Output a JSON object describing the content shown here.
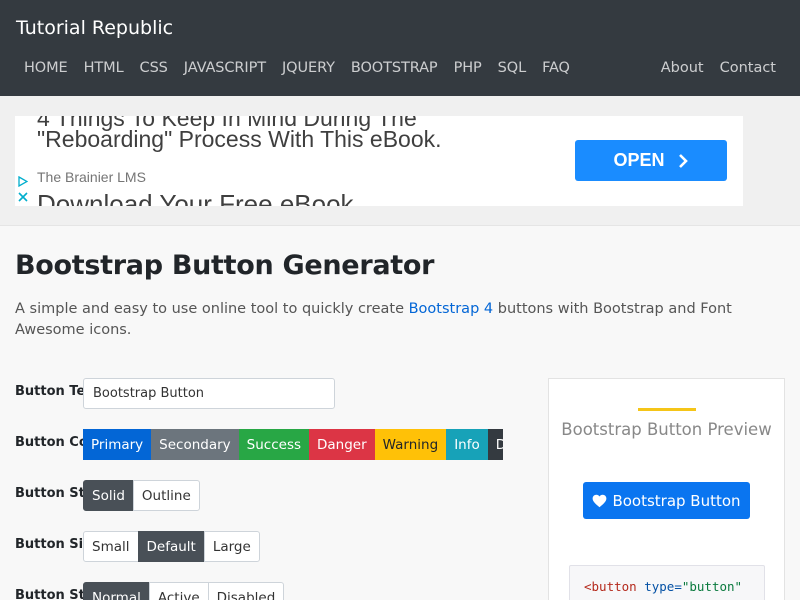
{
  "header": {
    "brand": "Tutorial Republic",
    "nav": [
      "HOME",
      "HTML",
      "CSS",
      "JAVASCRIPT",
      "JQUERY",
      "BOOTSTRAP",
      "PHP",
      "SQL",
      "FAQ"
    ],
    "nav_right": [
      "About",
      "Contact"
    ]
  },
  "ad": {
    "cut_top": "4 Things To Keep In Mind During The",
    "headline": "\"Reboarding\" Process With This eBook.",
    "source": "The Brainier LMS",
    "cut_bottom": "Download Your Free eBook",
    "button": "OPEN",
    "adchoices_icon": "play-triangle-icon",
    "close_icon": "close-icon"
  },
  "page": {
    "title": "Bootstrap Button Generator",
    "desc_before": "A simple and easy to use online tool to quickly create ",
    "desc_link": "Bootstrap 4",
    "desc_after": " buttons with Bootstrap and Font Awesome icons."
  },
  "form": {
    "rows": [
      {
        "label": "Button Text"
      },
      {
        "label": "Button Color"
      },
      {
        "label": "Button Style"
      },
      {
        "label": "Button Size"
      },
      {
        "label": "Button State"
      }
    ],
    "text_value": "Bootstrap Button",
    "colors": [
      "Primary",
      "Secondary",
      "Success",
      "Danger",
      "Warning",
      "Info",
      "Dark"
    ],
    "styles": [
      "Solid",
      "Outline"
    ],
    "sizes": [
      "Small",
      "Default",
      "Large"
    ],
    "states": [
      "Normal",
      "Active",
      "Disabled"
    ],
    "selected": {
      "style": "Solid",
      "size": "Default",
      "state": "Normal"
    }
  },
  "preview": {
    "title": "Bootstrap Button Preview",
    "button_label": "Bootstrap Button",
    "button_icon": "heart-icon",
    "code_tag": "<button",
    "code_attr": " type=",
    "code_value": "\"button\""
  },
  "colors": {
    "header_bg": "#343a40",
    "primary": "#0366d6",
    "preview_button": "#0a75f0",
    "accent_bar": "#f5c518"
  }
}
